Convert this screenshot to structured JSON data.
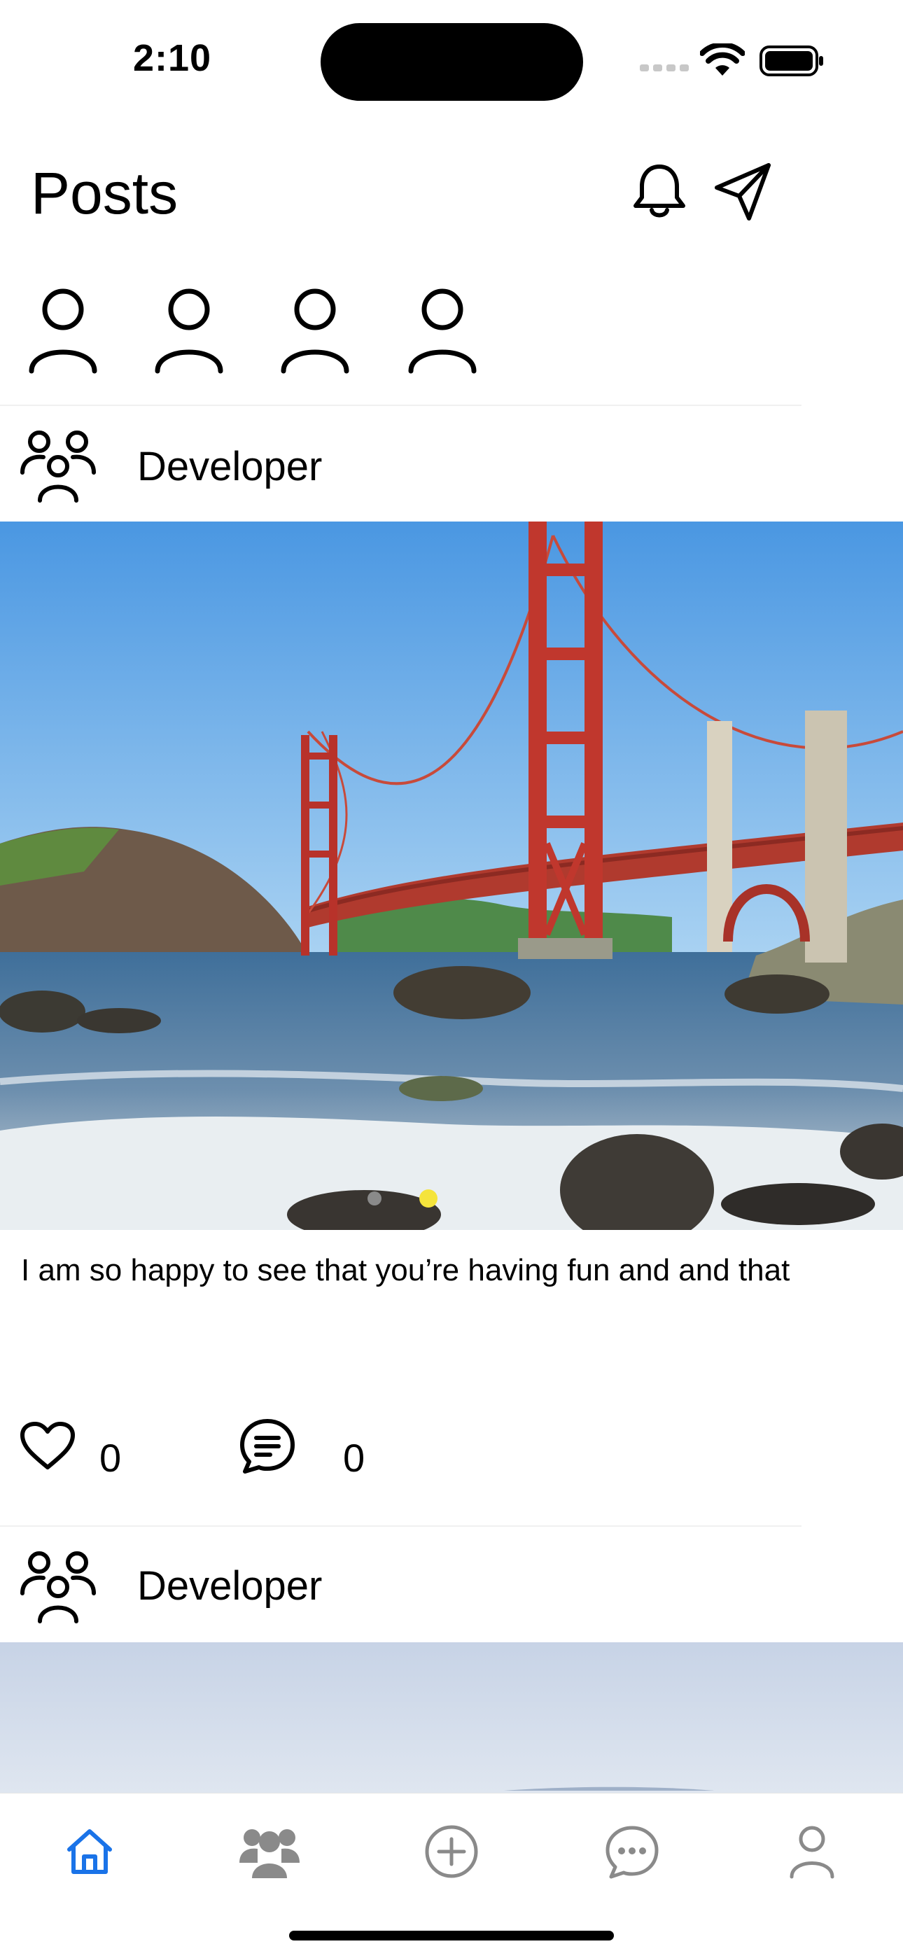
{
  "status_bar": {
    "time": "2:10"
  },
  "header": {
    "title": "Posts"
  },
  "stories": [
    {
      "name": "story-1"
    },
    {
      "name": "story-2"
    },
    {
      "name": "story-3"
    },
    {
      "name": "story-4"
    }
  ],
  "posts": [
    {
      "author": "Developer",
      "caption": "I am so happy to see that you’re having fun and and that",
      "likes": "0",
      "comments": "0",
      "carousel": {
        "count": 2,
        "active_index": 1
      }
    },
    {
      "author": "Developer"
    }
  ],
  "tab_bar": {
    "active": "home",
    "tabs": [
      "home",
      "groups",
      "create",
      "messages",
      "profile"
    ],
    "active_color": "#1a73e8",
    "inactive_color": "#8a8a8a"
  }
}
